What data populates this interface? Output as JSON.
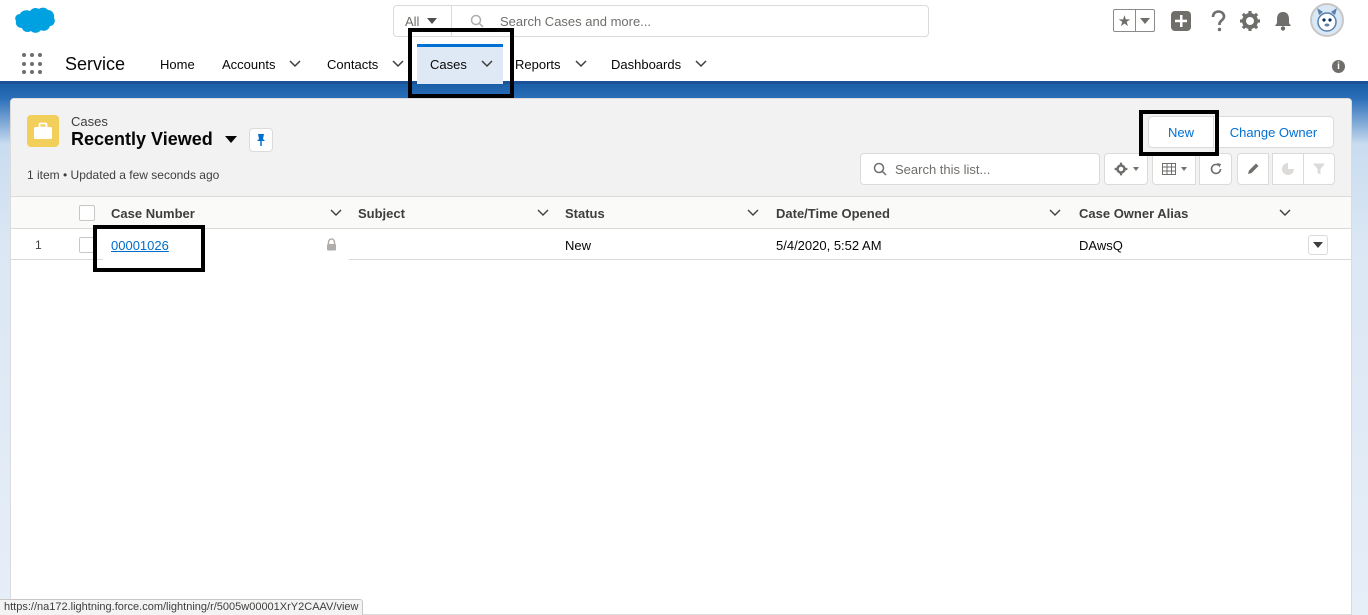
{
  "header": {
    "search_scope": "All",
    "search_placeholder": "Search Cases and more...",
    "icons": [
      "salesforce-cloud-logo",
      "favorites-star-icon",
      "add-icon",
      "help-icon",
      "setup-gear-icon",
      "notifications-bell-icon",
      "user-avatar"
    ]
  },
  "nav": {
    "app_name": "Service",
    "items": [
      {
        "label": "Home",
        "dropdown": false
      },
      {
        "label": "Accounts",
        "dropdown": true
      },
      {
        "label": "Contacts",
        "dropdown": true
      },
      {
        "label": "Cases",
        "dropdown": true,
        "active": true
      },
      {
        "label": "Reports",
        "dropdown": true
      },
      {
        "label": "Dashboards",
        "dropdown": true
      }
    ]
  },
  "list_view": {
    "object_label": "Cases",
    "title": "Recently Viewed",
    "meta": "1 item • Updated a few seconds ago",
    "new_button": "New",
    "change_owner_button": "Change Owner",
    "search_placeholder": "Search this list..."
  },
  "table": {
    "columns": [
      "Case Number",
      "Subject",
      "Status",
      "Date/Time Opened",
      "Case Owner Alias"
    ],
    "rows": [
      {
        "num": "1",
        "case_number": "00001026",
        "subject": "",
        "status": "New",
        "opened": "5/4/2020, 5:52 AM",
        "owner": "DAwsQ"
      }
    ]
  },
  "status_bar": {
    "url": "https://na172.lightning.force.com/lightning/r/5005w00001XrY2CAAV/view"
  },
  "colors": {
    "brand_blue": "#0070d2",
    "link_blue": "#006dcc",
    "cases_icon": "#f2cf5b",
    "logo_blue": "#00a1e0"
  }
}
